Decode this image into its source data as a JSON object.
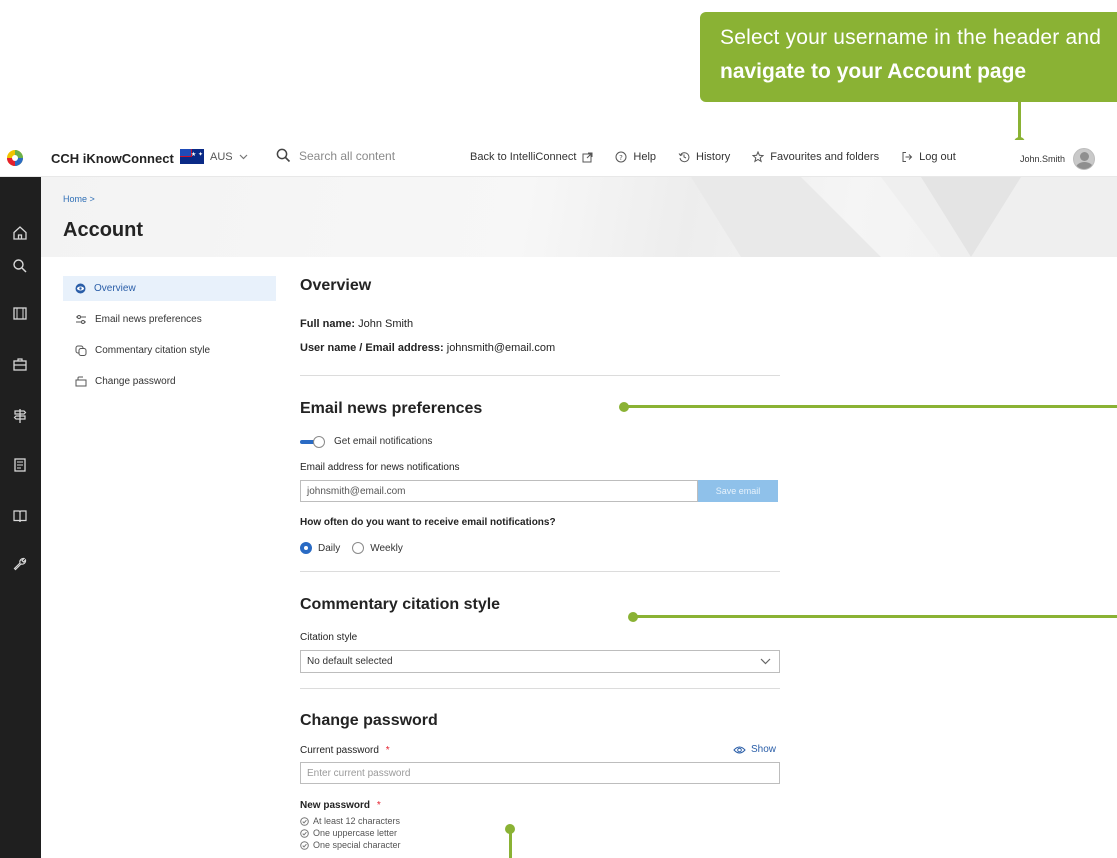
{
  "callout": {
    "line1": "Select your username in the header and",
    "line2": "navigate to your Account page"
  },
  "header": {
    "brand": "CCH iKnowConnect",
    "region": "AUS",
    "search_placeholder": "Search all content",
    "links": {
      "back": "Back to IntelliConnect",
      "help": "Help",
      "history": "History",
      "favourites": "Favourites and folders",
      "logout": "Log out"
    },
    "username": "John.Smith"
  },
  "breadcrumb": "Home  >",
  "page_title": "Account",
  "subnav": {
    "overview": "Overview",
    "email_prefs": "Email news preferences",
    "citation": "Commentary citation style",
    "password": "Change password"
  },
  "overview": {
    "heading": "Overview",
    "full_name_label": "Full name:",
    "full_name": "John Smith",
    "username_label": "User name / Email address:",
    "username_value": "johnsmith@email.com"
  },
  "email": {
    "heading": "Email news preferences",
    "toggle_label": "Get email notifications",
    "address_label": "Email address for news notifications",
    "address_value": "johnsmith@email.com",
    "save_label": "Save email",
    "frequency_label": "How often do you want to receive email notifications?",
    "daily": "Daily",
    "weekly": "Weekly"
  },
  "citation": {
    "heading": "Commentary citation style",
    "label": "Citation style",
    "selected": "No default selected"
  },
  "password": {
    "heading": "Change password",
    "current_label": "Current password",
    "required_mark": "*",
    "show_label": "Show",
    "current_placeholder": "Enter current password",
    "new_label": "New password",
    "rules": [
      "At least 12 characters",
      "One uppercase letter",
      "One special character"
    ]
  },
  "colors": {
    "accent_green": "#8ab234",
    "primary_blue": "#2a6bc4",
    "sidebar_dark": "#1f1f1f",
    "save_disabled": "#8fc1ea"
  }
}
